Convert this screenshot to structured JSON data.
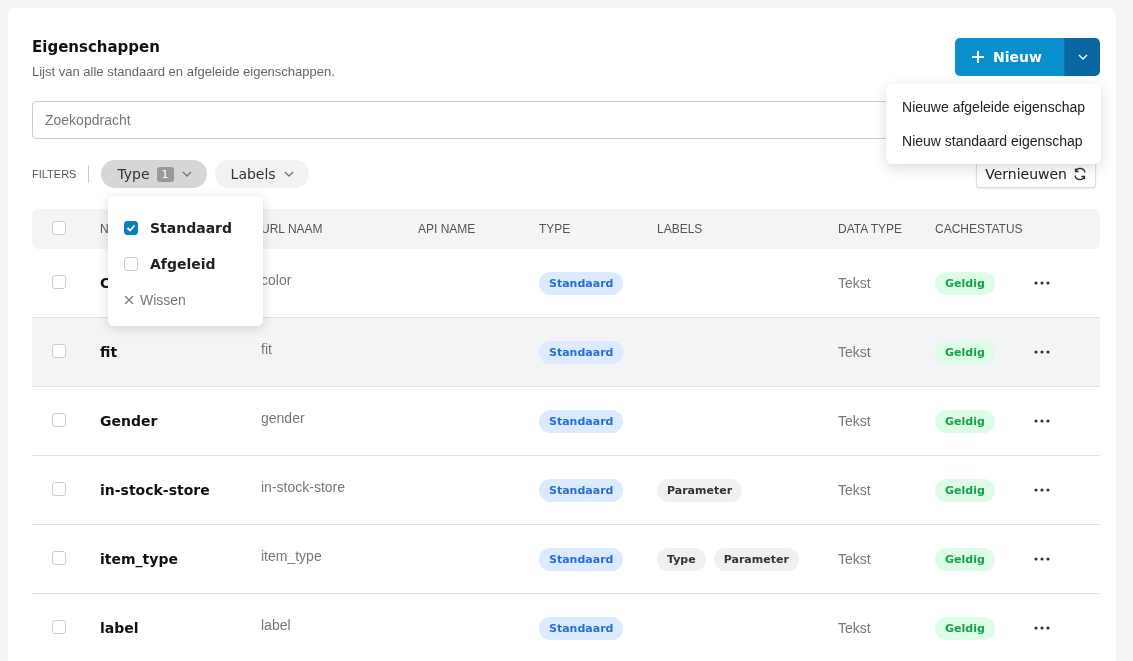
{
  "header": {
    "title": "Eigenschappen",
    "subtitle": "Lijst van alle standaard en afgeleide eigenschappen."
  },
  "new_button": {
    "label": "Nieuw"
  },
  "new_menu": {
    "open": true,
    "items": [
      "Nieuwe afgeleide eigenschap",
      "Nieuw standaard eigenschap"
    ]
  },
  "search": {
    "placeholder": "Zoekopdracht"
  },
  "filters": {
    "label": "FILTERS",
    "chips": [
      {
        "label": "Type",
        "count": "1",
        "open": true
      },
      {
        "label": "Labels",
        "open": false
      }
    ]
  },
  "type_filter_menu": {
    "options": [
      {
        "label": "Standaard",
        "checked": true
      },
      {
        "label": "Afgeleid",
        "checked": false
      }
    ],
    "clear": "Wissen"
  },
  "refresh_button": {
    "label": "Vernieuwen"
  },
  "table": {
    "select_all_checked": false,
    "columns": [
      "N",
      "URL NAAM",
      "API NAME",
      "TYPE",
      "LABELS",
      "DATA TYPE",
      "CACHESTATUS"
    ],
    "rows": [
      {
        "name": "C",
        "url": "color",
        "type": "Standaard",
        "labels": [],
        "data_type": "Tekst",
        "cache": "Geldig",
        "checked": false,
        "highlighted": false
      },
      {
        "name": "fit",
        "url": "fit",
        "type": "Standaard",
        "labels": [],
        "data_type": "Tekst",
        "cache": "Geldig",
        "checked": false,
        "highlighted": true
      },
      {
        "name": "Gender",
        "url": "gender",
        "type": "Standaard",
        "labels": [],
        "data_type": "Tekst",
        "cache": "Geldig",
        "checked": false,
        "highlighted": false
      },
      {
        "name": "in-stock-store",
        "url": "in-stock-store",
        "type": "Standaard",
        "labels": [
          "Parameter"
        ],
        "data_type": "Tekst",
        "cache": "Geldig",
        "checked": false,
        "highlighted": false
      },
      {
        "name": "item_type",
        "url": "item_type",
        "type": "Standaard",
        "labels": [
          "Type",
          "Parameter"
        ],
        "data_type": "Tekst",
        "cache": "Geldig",
        "checked": false,
        "highlighted": false
      },
      {
        "name": "label",
        "url": "label",
        "type": "Standaard",
        "labels": [],
        "data_type": "Tekst",
        "cache": "Geldig",
        "checked": false,
        "highlighted": false
      }
    ]
  }
}
